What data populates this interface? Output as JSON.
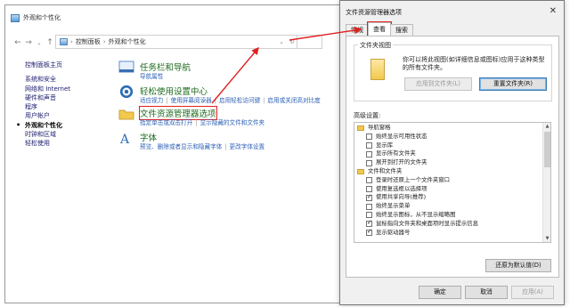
{
  "control_panel": {
    "title": "外观和个性化",
    "nav": {
      "back": "←",
      "forward": "→",
      "up": "↑",
      "dropdown": "⌄",
      "refresh": "↻"
    },
    "breadcrumb": [
      "控制面板",
      "外观和个性化"
    ],
    "breadcrumb_sep": "›",
    "sidebar": [
      "控制面板主页",
      "系统和安全",
      "网络和 Internet",
      "硬件和声音",
      "程序",
      "用户帐户",
      "外观和个性化",
      "时钟和区域",
      "轻松使用"
    ],
    "active_bullet": "•",
    "categories": [
      {
        "title": "任务栏和导航",
        "links": [
          "导航属性"
        ]
      },
      {
        "title": "轻松使用设置中心",
        "links": [
          "适应视力",
          "使用屏幕阅读器",
          "启用轻松访问键",
          "启用或关闭高对比度"
        ]
      },
      {
        "title": "文件资源管理器选项",
        "links": [
          "指定单击或双击打开",
          "显示隐藏的文件和文件夹"
        ]
      },
      {
        "title": "字体",
        "links": [
          "预览、删除或者显示和隐藏字体",
          "更改字体设置"
        ]
      }
    ]
  },
  "dialog": {
    "title": "文件资源管理器选项",
    "close": "✕",
    "tabs": [
      "常规",
      "查看",
      "搜索"
    ],
    "folder_views": {
      "label": "文件夹视图",
      "description": "你可以将此视图(如详细信息或图标)应用于这种类型的所有文件夹。",
      "apply_button": "应用到文件夹(L)",
      "reset_button": "重置文件夹(R)"
    },
    "advanced_label": "高级设置:",
    "advanced_items": [
      {
        "type": "folder",
        "label": "导航窗格"
      },
      {
        "type": "check",
        "label": "始终显示可用性状态",
        "checked": false
      },
      {
        "type": "check",
        "label": "显示库",
        "checked": false
      },
      {
        "type": "check",
        "label": "显示所有文件夹",
        "checked": false
      },
      {
        "type": "check",
        "label": "展开到打开的文件夹",
        "checked": false
      },
      {
        "type": "folder",
        "label": "文件和文件夹"
      },
      {
        "type": "check",
        "label": "登录时还原上一个文件夹窗口",
        "checked": false
      },
      {
        "type": "check",
        "label": "使用复选框以选择项",
        "checked": false
      },
      {
        "type": "check",
        "label": "使用共享向导(推荐)",
        "checked": true
      },
      {
        "type": "check",
        "label": "始终显示菜单",
        "checked": false
      },
      {
        "type": "check",
        "label": "始终显示图标，从不显示缩略图",
        "checked": false
      },
      {
        "type": "check",
        "label": "鼠标指向文件夹和桌面项时显示提示信息",
        "checked": true
      },
      {
        "type": "check",
        "label": "显示驱动器号",
        "checked": true
      }
    ],
    "restore_defaults": "还原为默认值(D)",
    "ok": "确定",
    "cancel": "取消",
    "apply": "应用(A)"
  },
  "colors": {
    "annotation": "#e02020",
    "link": "#2b5fb4",
    "category_title": "#1e6a1e"
  }
}
